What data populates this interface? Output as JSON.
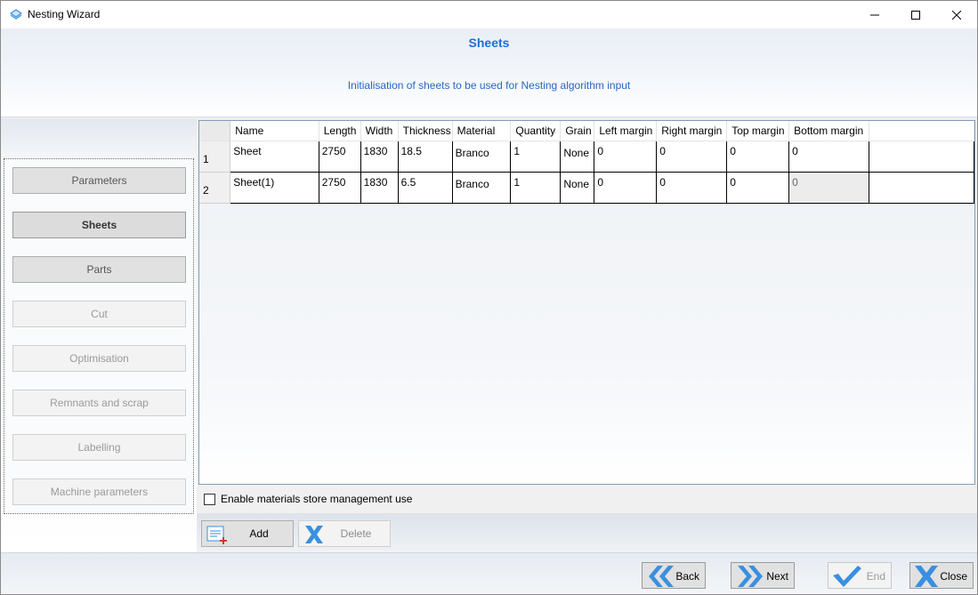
{
  "window": {
    "title": "Nesting Wizard",
    "icons": {
      "app": "nesting-app-icon",
      "minimize": "minimize-icon",
      "maximize": "maximize-icon",
      "close": "close-icon"
    }
  },
  "header": {
    "title": "Sheets",
    "subtitle": "Initialisation of sheets to be used for Nesting algorithm input"
  },
  "steps": [
    {
      "label": "Parameters",
      "state": "enabled"
    },
    {
      "label": "Sheets",
      "state": "current"
    },
    {
      "label": "Parts",
      "state": "enabled"
    },
    {
      "label": "Cut",
      "state": "disabled"
    },
    {
      "label": "Optimisation",
      "state": "disabled"
    },
    {
      "label": "Remnants and scrap",
      "state": "disabled"
    },
    {
      "label": "Labelling",
      "state": "disabled"
    },
    {
      "label": "Machine parameters",
      "state": "disabled"
    }
  ],
  "grid": {
    "columns": [
      "Name",
      "Length",
      "Width",
      "Thickness",
      "Material",
      "Quantity",
      "Grain",
      "Left margin",
      "Right margin",
      "Top margin",
      "Bottom margin"
    ],
    "rows": [
      {
        "index": "1",
        "cells": [
          "Sheet",
          "2750",
          "1830",
          "18.5",
          "Branco",
          "1",
          "None",
          "0",
          "0",
          "0",
          "0"
        ]
      },
      {
        "index": "2",
        "cells": [
          "Sheet(1)",
          "2750",
          "1830",
          "6.5",
          "Branco",
          "1",
          "None",
          "0",
          "0",
          "0",
          "0"
        ]
      }
    ]
  },
  "options": {
    "materials_store_label": "Enable materials store management use",
    "materials_store_checked": false
  },
  "toolbar": {
    "add_label": "Add",
    "delete_label": "Delete"
  },
  "footer": {
    "back_label": "Back",
    "next_label": "Next",
    "end_label": "End",
    "close_label": "Close"
  },
  "colors": {
    "accent": "#1f6ed4",
    "icon_blue": "#3a8fe0",
    "add_red": "#e03030"
  }
}
